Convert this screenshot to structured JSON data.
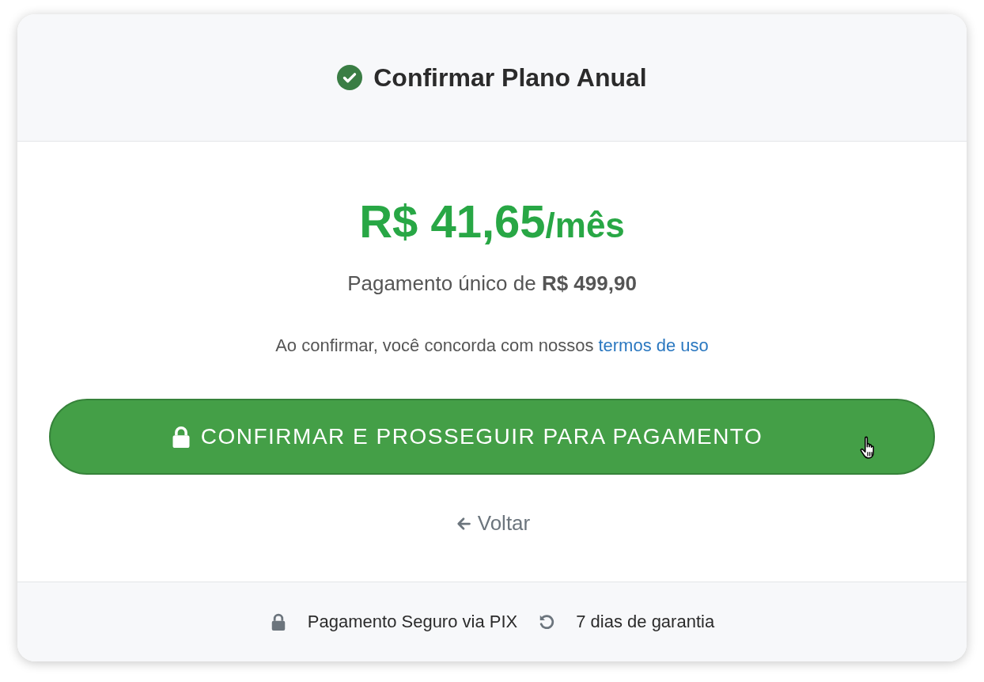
{
  "header": {
    "title": "Confirmar Plano Anual"
  },
  "price": {
    "amount": "R$ 41,65",
    "period": "/mês"
  },
  "payment_note": "Pagamento único de **R$ 499,90**",
  "terms": {
    "text": "Ao confirmar, você concorda com nossos",
    "link": "termos de uso"
  },
  "confirm_button": {
    "label": "CONFIRMAR E PROSSEGUIR PARA PAGAMENTO"
  },
  "back_link": {
    "label": "Voltar"
  },
  "footer": [
    {
      "kind": "lock",
      "label": "Pagamento Seguro via PIX"
    },
    {
      "kind": "undo",
      "label": "7 dias de garantia"
    }
  ]
}
